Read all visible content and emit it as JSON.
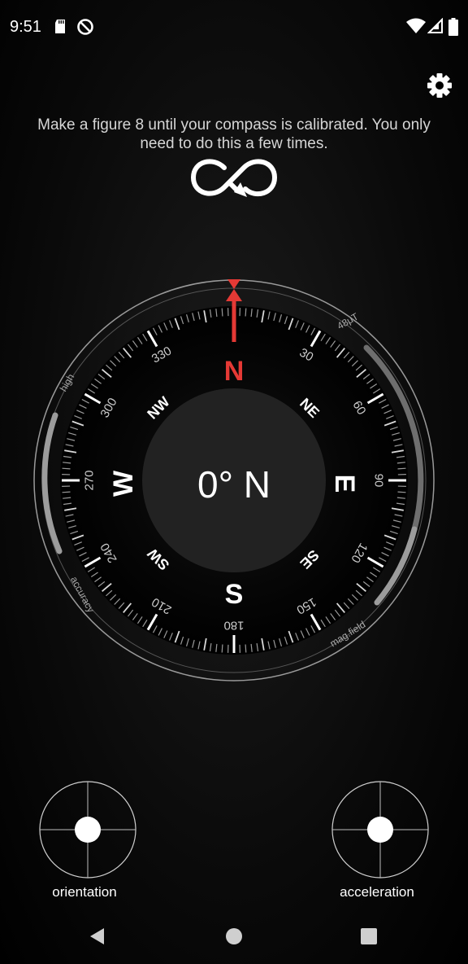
{
  "status_bar": {
    "time": "9:51",
    "left_icons": [
      "sd-card-icon",
      "do-not-disturb-icon"
    ],
    "right_icons": [
      "wifi-icon",
      "signal-icon",
      "battery-icon"
    ]
  },
  "toolbar": {
    "settings_icon": "gear-icon"
  },
  "calibration": {
    "message": "Make a figure 8 until your compass is calibrated. You only need to do this a few times.",
    "icon": "figure-eight-icon"
  },
  "compass": {
    "heading_text": "0° N",
    "heading_degrees": 0,
    "cardinals": {
      "n": "N",
      "e": "E",
      "s": "S",
      "w": "W"
    },
    "intercardinals": {
      "ne": "NE",
      "se": "SE",
      "sw": "SW",
      "nw": "NW"
    },
    "degree_labels": [
      "30",
      "60",
      "90",
      "120",
      "150",
      "180",
      "210",
      "240",
      "270",
      "300",
      "330"
    ],
    "accuracy_gauge": {
      "label": "accuracy",
      "max_label": "high",
      "level": 1.0
    },
    "magfield_gauge": {
      "label": "mag.field",
      "max_label": "48μT",
      "level": 0.7
    },
    "colors": {
      "north": "#e53935",
      "dial": "#000000",
      "center": "#222222"
    }
  },
  "sensors": {
    "orientation": {
      "label": "orientation",
      "dot_x": 0,
      "dot_y": 0
    },
    "acceleration": {
      "label": "acceleration",
      "dot_x": 0,
      "dot_y": 0
    }
  },
  "nav_bar": {
    "back_icon": "back-icon",
    "home_icon": "home-icon",
    "recents_icon": "recents-icon"
  }
}
